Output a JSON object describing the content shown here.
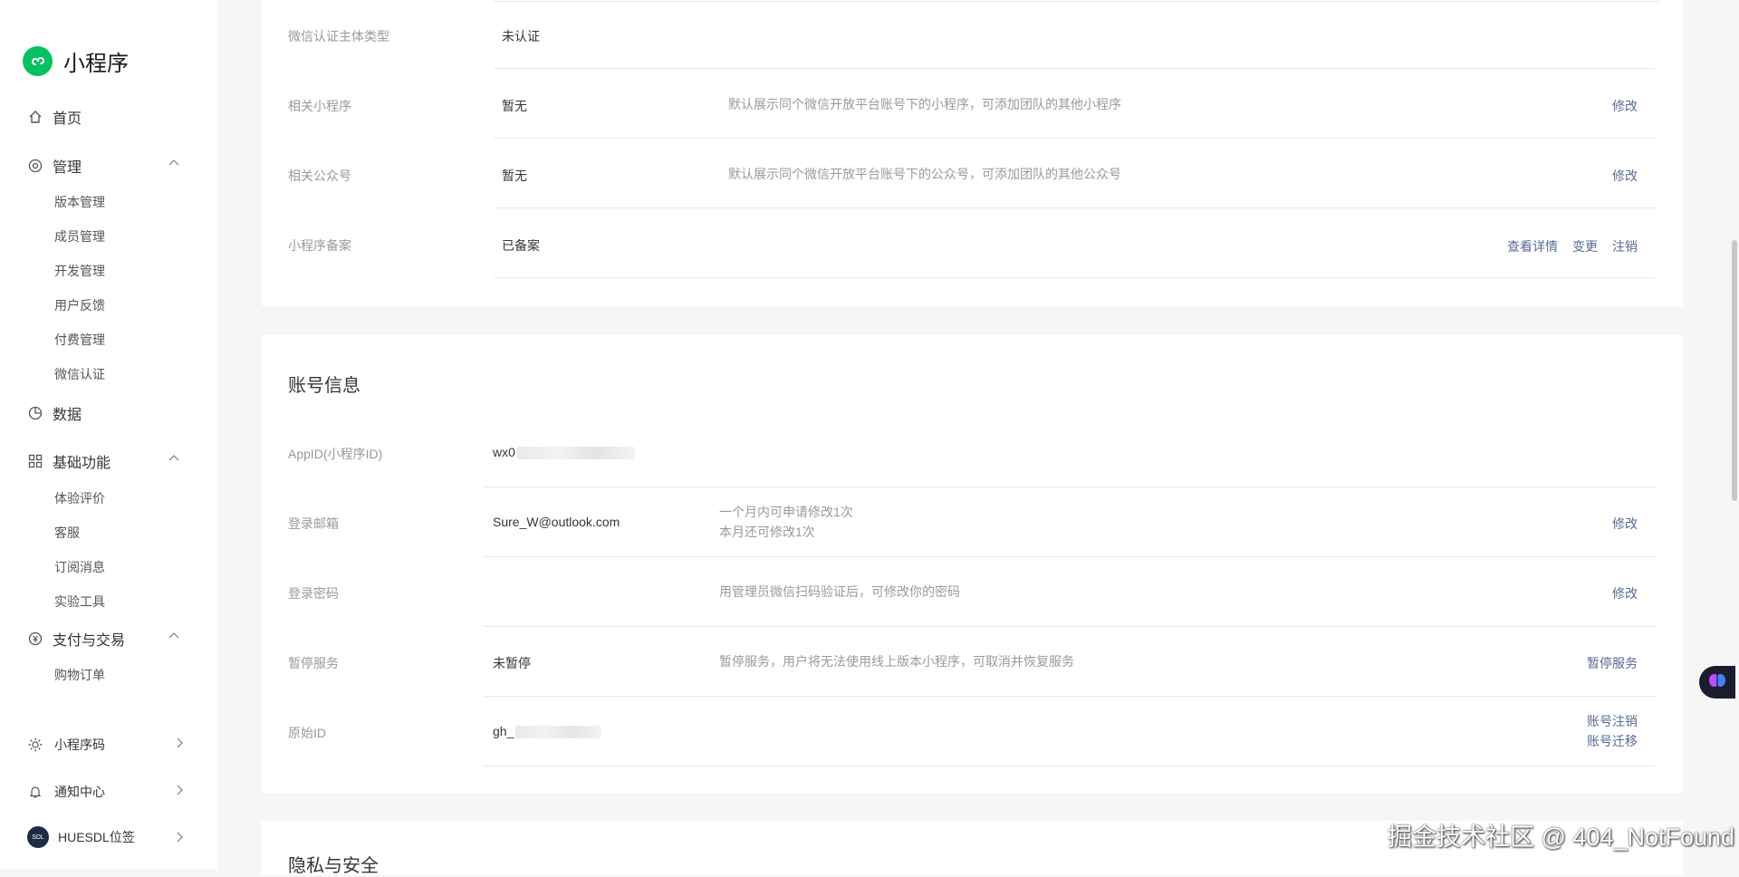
{
  "app": {
    "title": "小程序"
  },
  "sidebar": {
    "home": "首页",
    "manage": {
      "label": "管理",
      "items": [
        "版本管理",
        "成员管理",
        "开发管理",
        "用户反馈",
        "付费管理",
        "微信认证"
      ]
    },
    "data": "数据",
    "basic": {
      "label": "基础功能",
      "items": [
        "体验评价",
        "客服",
        "订阅消息",
        "实验工具"
      ]
    },
    "pay": {
      "label": "支付与交易",
      "items": [
        "购物订单"
      ]
    },
    "bottom": {
      "qrcode": "小程序码",
      "notify": "通知中心",
      "account": "HUESDL位签",
      "avatar_text": "SDL"
    }
  },
  "top_card": {
    "rows": [
      {
        "label": "微信认证主体类型",
        "value": "未认证",
        "desc": "",
        "actions": []
      },
      {
        "label": "相关小程序",
        "value": "暂无",
        "desc": "默认展示同个微信开放平台账号下的小程序，可添加团队的其他小程序",
        "actions": [
          "修改"
        ]
      },
      {
        "label": "相关公众号",
        "value": "暂无",
        "desc": "默认展示同个微信开放平台账号下的公众号，可添加团队的其他公众号",
        "actions": [
          "修改"
        ]
      },
      {
        "label": "小程序备案",
        "value": "已备案",
        "desc": "",
        "actions": [
          "查看详情",
          "变更",
          "注销"
        ]
      }
    ]
  },
  "account": {
    "title": "账号信息",
    "appid": {
      "label": "AppID(小程序ID)",
      "value": "wx0"
    },
    "email": {
      "label": "登录邮箱",
      "value": "Sure_W@outlook.com",
      "desc1": "一个月内可申请修改1次",
      "desc2": "本月还可修改1次",
      "action": "修改"
    },
    "password": {
      "label": "登录密码",
      "desc": "用管理员微信扫码验证后，可修改你的密码",
      "action": "修改"
    },
    "pause": {
      "label": "暂停服务",
      "value": "未暂停",
      "desc": "暂停服务，用户将无法使用线上版本小程序，可取消并恢复服务",
      "action": "暂停服务"
    },
    "origin": {
      "label": "原始ID",
      "value": "gh_",
      "action1": "账号注销",
      "action2": "账号迁移"
    }
  },
  "privacy": {
    "title": "隐私与安全"
  },
  "watermark": "掘金技术社区 @ 404_NotFound",
  "colors": {
    "brand": "#07c160",
    "link": "#576b95"
  }
}
